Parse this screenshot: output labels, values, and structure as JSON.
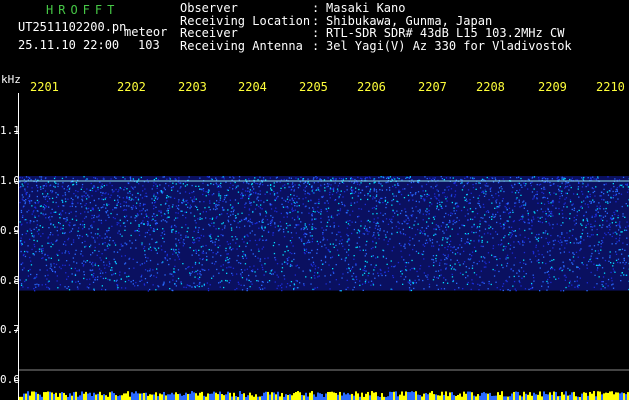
{
  "header": {
    "brand": "HROFFT",
    "file_name": "UT2511102200.pn",
    "file_label": "meteor",
    "datetime": "25.11.10 22:00",
    "count": "103"
  },
  "info": [
    {
      "key": "Observer",
      "sep": ":",
      "value": "Masaki Kano"
    },
    {
      "key": "Receiving Location",
      "sep": ":",
      "value": "Shibukawa, Gunma, Japan"
    },
    {
      "key": "Receiver",
      "sep": ":",
      "value": "RTL-SDR SDR# 43dB L15 103.2MHz CW"
    },
    {
      "key": "Receiving Antenna",
      "sep": ":",
      "value": "3el Yagi(V) Az 330 for Vladivostok"
    }
  ],
  "y_axis": {
    "unit": "kHz",
    "ticks": [
      {
        "label": "1.1",
        "value": 1.1
      },
      {
        "label": "1.0",
        "value": 1.0
      },
      {
        "label": "0.9",
        "value": 0.9
      },
      {
        "label": "0.8",
        "value": 0.8
      },
      {
        "label": "0.7",
        "value": 0.7
      },
      {
        "label": "0.6",
        "value": 0.6
      }
    ],
    "range": [
      0.59,
      1.2
    ]
  },
  "x_axis": {
    "ticks": [
      "2201",
      "2202",
      "2203",
      "2204",
      "2205",
      "2206",
      "2207",
      "2208",
      "2209",
      "2210"
    ]
  },
  "spectrogram": {
    "band_top_khz": 1.01,
    "band_bottom_khz": 0.78,
    "echo_line_khz": 1.0,
    "colors": {
      "background": "#000000",
      "noise_low": "#1a2bd8",
      "noise_mid": "#2a6aff",
      "noise_high": "#00e0ff",
      "echo": "#9fffff",
      "baseline": "#ffff00",
      "axis_text": "#ffffff",
      "time_labels": "#ffff3a",
      "brand": "#46c846"
    }
  }
}
